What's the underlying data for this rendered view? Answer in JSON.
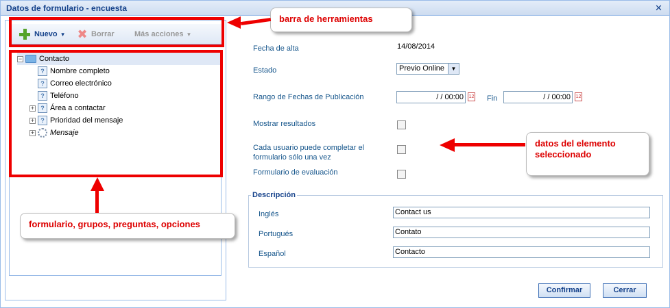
{
  "window": {
    "title": "Datos de formulario - encuesta",
    "close_glyph": "✕"
  },
  "toolbar": {
    "new_label": "Nuevo",
    "delete_label": "Borrar",
    "more_label": "Más acciones"
  },
  "tree": {
    "root": "Contacto",
    "items": [
      {
        "label": "Nombre completo",
        "expandable": false,
        "icon": "question-icon",
        "italic": false
      },
      {
        "label": "Correo electrónico",
        "expandable": false,
        "icon": "question-icon",
        "italic": false
      },
      {
        "label": "Teléfono",
        "expandable": false,
        "icon": "question-icon",
        "italic": false
      },
      {
        "label": "Área a contactar",
        "expandable": true,
        "icon": "question-icon",
        "italic": false
      },
      {
        "label": "Prioridad del mensaje",
        "expandable": true,
        "icon": "question-icon",
        "italic": false
      },
      {
        "label": "Mensaje",
        "expandable": true,
        "icon": "gear-icon",
        "italic": true
      }
    ]
  },
  "form": {
    "fecha_alta_label": "Fecha de alta",
    "fecha_alta_value": "14/08/2014",
    "estado_label": "Estado",
    "estado_value": "Previo Online",
    "rango_label": "Rango de Fechas de Publicación",
    "fin_label": "Fin",
    "date_start_value": "/  /  00:00",
    "date_end_value": "/  /  00:00",
    "mostrar_label": "Mostrar resultados",
    "cada_usuario_line1": "Cada usuario puede completar el",
    "cada_usuario_line2": "formulario sólo una vez",
    "evaluacion_label": "Formulario de evaluación"
  },
  "descripcion": {
    "legend": "Descripción",
    "rows": [
      {
        "label": "Inglés",
        "value": "Contact us"
      },
      {
        "label": "Portugués",
        "value": "Contato"
      },
      {
        "label": "Español",
        "value": "Contacto"
      }
    ]
  },
  "buttons": {
    "confirm": "Confirmar",
    "close": "Cerrar"
  },
  "annotations": {
    "toolbar_note": "barra de herramientas",
    "data_note_line1": "datos del elemento",
    "data_note_line2": "seleccionado",
    "tree_note": "formulario, grupos, preguntas, opciones",
    "color": "#e00000"
  }
}
